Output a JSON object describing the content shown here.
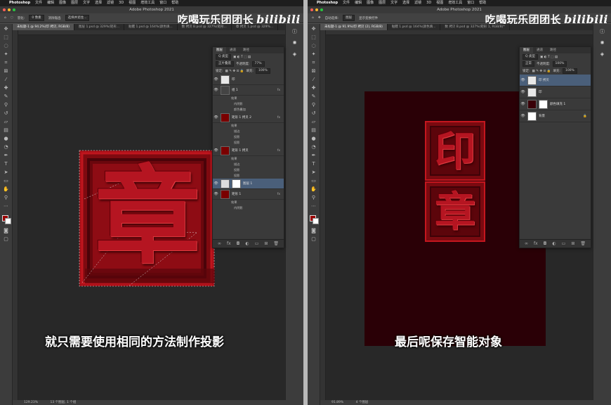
{
  "left": {
    "menubar": [
      "Photoshop",
      "文件",
      "编辑",
      "图像",
      "图层",
      "文字",
      "选择",
      "滤镜",
      "3D",
      "视图",
      "增效工具",
      "窗口",
      "帮助"
    ],
    "window_title": "Adobe Photoshop 2021",
    "options": {
      "feather_label": "羽化:",
      "feather_value": "0 像素",
      "antialias": "消除锯齿",
      "select_mask": "选择并遮住..."
    },
    "tabs": [
      "未标题-1 @ 94.2%(印 拷贝, RGB/8)",
      "图层 1.psd @ 329%(矩形...",
      "骷髅 1.psd @ 164%(颜色填...",
      "数 拷贝 B.psd @ 327%(矩形...",
      "章 拷贝 1.psd @ 329%..."
    ],
    "layers_panel": {
      "tabs": [
        "图层",
        "通道",
        "路径"
      ],
      "kind": "Q 类型",
      "blend": "正片叠底",
      "opacity_label": "不透明度:",
      "opacity": "77%",
      "lock_label": "锁定:",
      "fill_label": "填充:",
      "fill": "100%",
      "layers": [
        {
          "name": "印",
          "thumb": "#e8e8e8",
          "effects": []
        },
        {
          "name": "组 1",
          "thumb": "#444",
          "effects": [
            "效果",
            "内阴影",
            "颜色叠加"
          ]
        },
        {
          "name": "矩形 1 拷贝 2",
          "thumb": "#7a0000",
          "effects": [
            "效果",
            "描边",
            "投影",
            "投影"
          ]
        },
        {
          "name": "矩形 1 拷贝",
          "thumb": "#7a0000",
          "effects": [
            "效果",
            "描边",
            "投影",
            "投影"
          ]
        },
        {
          "name": "图层 1",
          "thumb": "#dcdcdc",
          "effects": []
        },
        {
          "name": "矩形 1",
          "thumb": "#7a0000",
          "effects": [
            "效果",
            "内阴影"
          ]
        }
      ],
      "selected": "图层 1"
    },
    "stamp_char": "章",
    "subtitle": "就只需要使用相同的方法制作投影",
    "status": {
      "zoom": "129.23%",
      "info": "13 个图层, 1 个组"
    }
  },
  "right": {
    "menubar": [
      "Photoshop",
      "文件",
      "编辑",
      "图像",
      "图层",
      "文字",
      "选择",
      "滤镜",
      "3D",
      "视图",
      "增效工具",
      "窗口",
      "帮助"
    ],
    "window_title": "Adobe Photoshop 2021",
    "options": {
      "auto_select": "自动选择:",
      "auto_select_value": "图层",
      "show_transform": "显示变换控件"
    },
    "tabs": [
      "未标题-1 @ 91.9%(印 拷贝 (2), RGB/8)",
      "骷髅 1.psd @ 164%(颜色填...",
      "数 拷贝 B.psd @ 327%(矩形 1, RGB/8)*"
    ],
    "layers_panel": {
      "tabs": [
        "图层",
        "通道",
        "路径"
      ],
      "kind": "Q 类型",
      "blend": "正常",
      "opacity_label": "不透明度:",
      "opacity": "100%",
      "lock_label": "锁定:",
      "fill_label": "填充:",
      "fill": "100%",
      "layers": [
        {
          "name": "印 拷贝",
          "thumb": "#e8e8e8"
        },
        {
          "name": "印",
          "thumb": "#e8e8e8"
        },
        {
          "name": "颜色填充 1",
          "thumb": "#3a0008"
        },
        {
          "name": "背景",
          "thumb": "#ffffff"
        }
      ],
      "selected": "印 拷贝"
    },
    "stamp_chars": [
      "印",
      "章"
    ],
    "subtitle": "最后呢保存智能对象",
    "status": {
      "zoom": "91.89%",
      "info": "4 个图层"
    }
  },
  "watermark": {
    "text": "吃喝玩乐团团长",
    "brand": "bilibili"
  },
  "colors": {
    "stamp_red": "#8b0b12",
    "stamp_bg_right": "#2a0006",
    "canvas": "#282828",
    "accent_selected": "#4a5f7a"
  }
}
